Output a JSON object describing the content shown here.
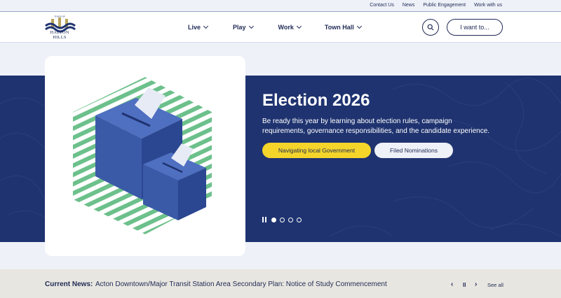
{
  "utility": {
    "links": [
      "Contact Us",
      "News",
      "Public Engagement",
      "Work with us"
    ]
  },
  "logo": {
    "text": "HALTON HILLS",
    "top_text": "TOWN OF"
  },
  "nav": {
    "items": [
      "Live",
      "Play",
      "Work",
      "Town Hall"
    ]
  },
  "header": {
    "search_icon": "search-icon",
    "iwant_label": "I want to..."
  },
  "hero": {
    "title": "Election 2026",
    "description": "Be ready this year by learning about election rules, campaign requirements, governance responsibilities, and the candidate experience.",
    "primary_button": "Navigating local Government",
    "secondary_button": "Filed Nominations",
    "slides_total": 4,
    "active_slide": 1
  },
  "news": {
    "label": "Current News:",
    "headline": "Acton Downtown/Major Transit Station Area Secondary Plan: Notice of Study Commencement",
    "prev": "‹",
    "pause": "II",
    "next": "›",
    "see_all": "See all"
  },
  "colors": {
    "navy": "#1f3370",
    "text": "#1f2a55",
    "yellow": "#f5d52a",
    "green_stripes": "#6cc08b",
    "ballot_blue": "#3a5aa8"
  }
}
